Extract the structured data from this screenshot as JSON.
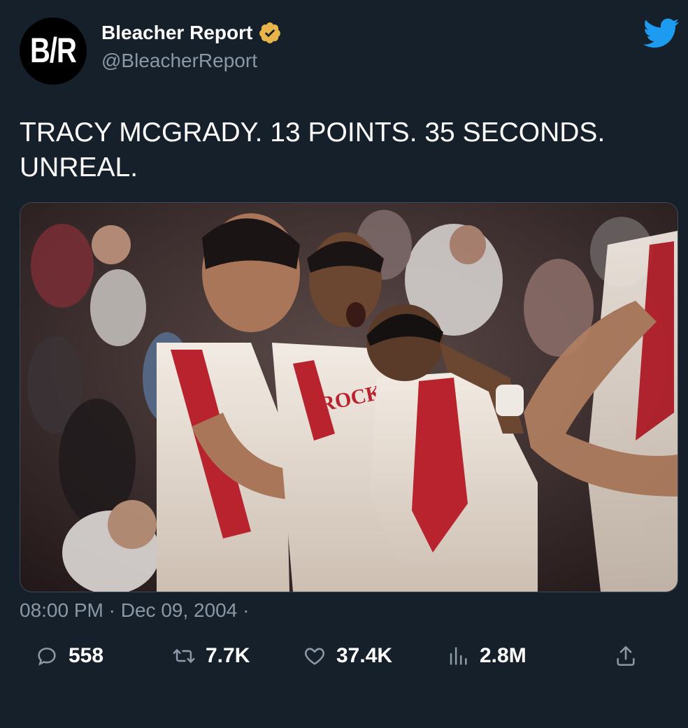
{
  "header": {
    "avatar_text": "B/R",
    "display_name": "Bleacher Report",
    "handle": "@BleacherReport",
    "verified_color": "#e7b549",
    "brand_icon": "twitter-bird-icon",
    "brand_color": "#1d9bf0"
  },
  "tweet": {
    "text_line1": "TRACY MCGRADY. 13 POINTS. 35 SECONDS.",
    "text_line2": "UNREAL.",
    "time": "08:00 PM",
    "separator": " · ",
    "date": "Dec 09, 2004",
    "trailing_dot": " ·"
  },
  "media": {
    "jersey_text": "ROCK"
  },
  "actions": {
    "reply_count": "558",
    "retweet_count": "7.7K",
    "like_count": "37.4K",
    "views_count": "2.8M",
    "icons": [
      "reply-icon",
      "retweet-icon",
      "like-icon",
      "views-icon",
      "share-icon"
    ]
  },
  "colors": {
    "background": "#15202b",
    "secondary_text": "#8b98a5",
    "primary_text": "#ffffff"
  }
}
